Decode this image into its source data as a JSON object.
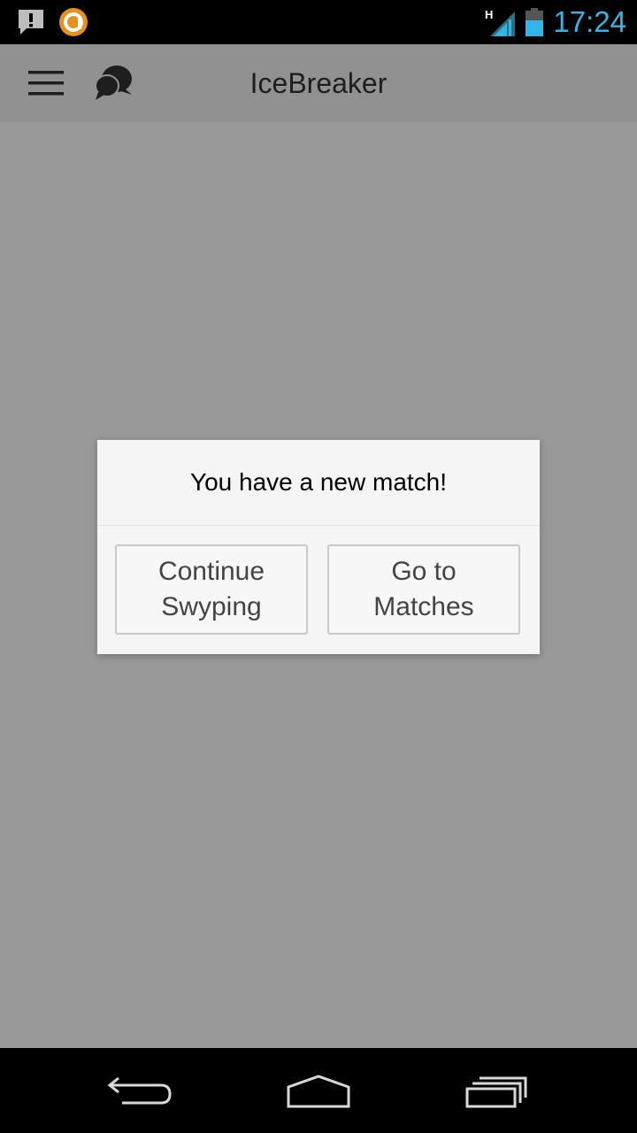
{
  "status_bar": {
    "time": "17:24",
    "network_type": "H",
    "icons": [
      "alert-notification-icon",
      "avast-icon",
      "signal-icon",
      "battery-icon"
    ]
  },
  "action_bar": {
    "title": "IceBreaker",
    "icons": [
      "menu-icon",
      "chat-bubbles-icon"
    ]
  },
  "dialog": {
    "message": "You have a new match!",
    "left_button": "Continue Swyping",
    "right_button": "Go to Matches"
  },
  "nav_bar": {
    "icons": [
      "back-icon",
      "home-icon",
      "recent-apps-icon"
    ]
  },
  "colors": {
    "status_time": "#33b5e5",
    "dim_overlay": "rgba(0,0,0,0.4)",
    "dialog_background": "#f5f5f5",
    "avast_orange": "#e8901a"
  }
}
